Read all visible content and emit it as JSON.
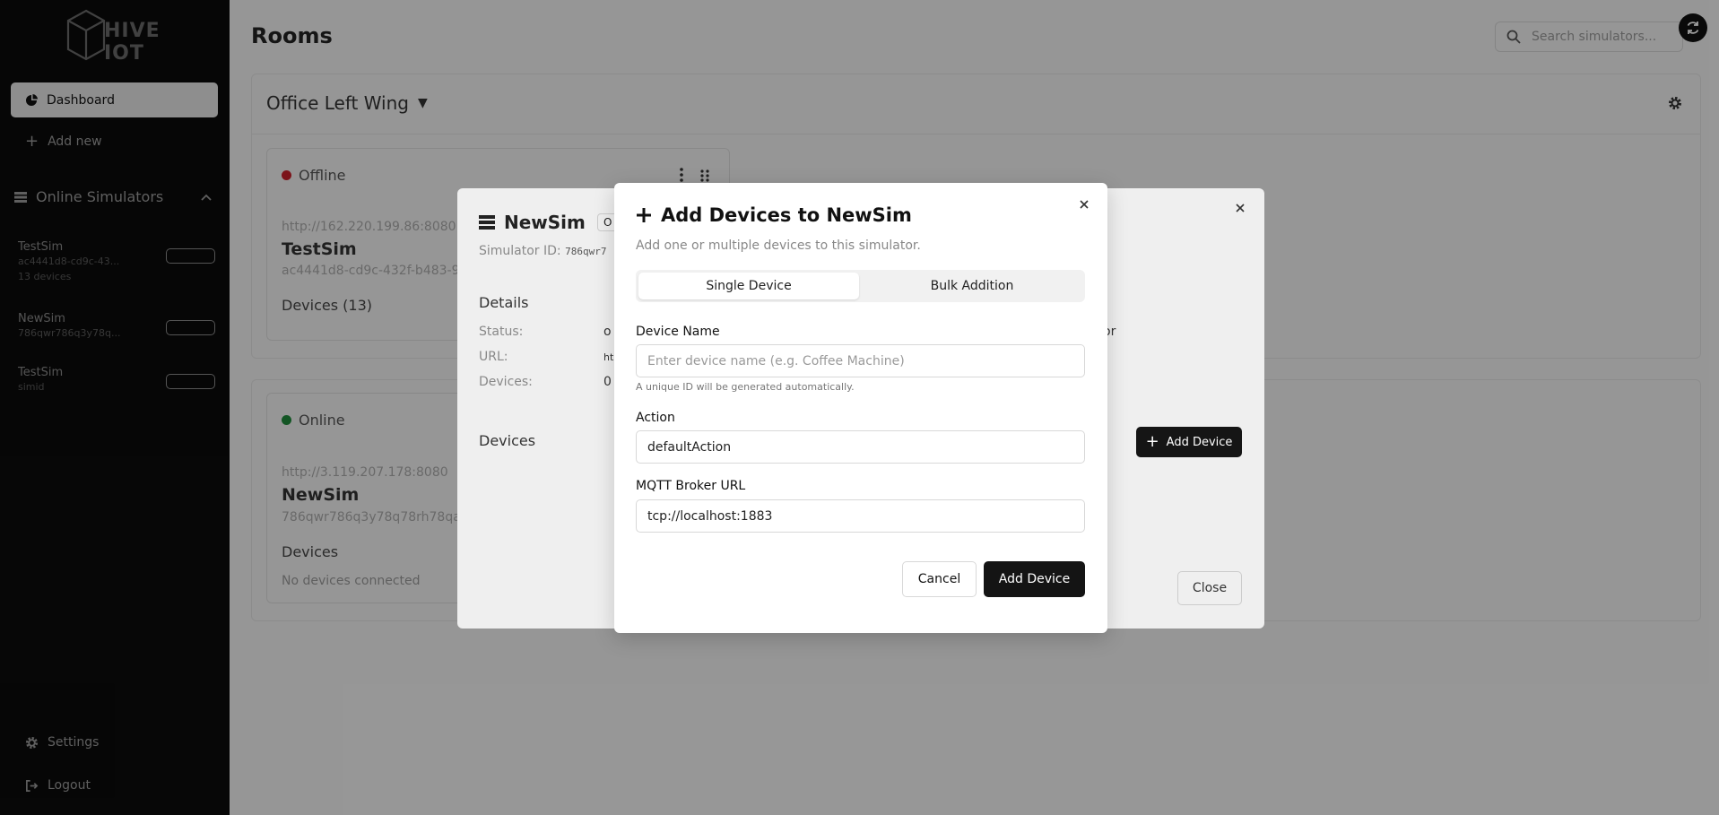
{
  "sidebar": {
    "logo_text": "HIVE IOT",
    "nav": {
      "dashboard": "Dashboard",
      "add_new": "Add new"
    },
    "section_title": "Online Simulators",
    "simulators": [
      {
        "name": "TestSim",
        "id": "ac4441d8-cd9c-43...",
        "count": "13 devices"
      },
      {
        "name": "NewSim",
        "id": "786qwr786q3y78q..."
      },
      {
        "name": "TestSim",
        "id": "simid"
      }
    ],
    "settings": "Settings",
    "logout": "Logout"
  },
  "header": {
    "title": "Rooms",
    "search_placeholder": "Search simulators..."
  },
  "room": {
    "name": "Office Left Wing",
    "cards": [
      {
        "status": "Offline",
        "status_color": "#c8202b",
        "url": "http://162.220.199.86:8080",
        "name": "TestSim",
        "id": "ac4441d8-cd9c-432f-b483-9",
        "devices": "Devices (13)"
      },
      {
        "status": "Online",
        "status_color": "#1f8a3a",
        "url": "http://3.119.207.178:8080",
        "name": "NewSim",
        "id": "786qwr786q3y78q78rh78qa",
        "devices": "Devices",
        "empty": "No devices connected"
      }
    ]
  },
  "detail_dialog": {
    "title": "NewSim",
    "badge": "O",
    "simulator_id_label": "Simulator ID:",
    "simulator_id": "786qwr7",
    "details_heading": "Details",
    "status_label": "Status:",
    "status_value": "o",
    "url_label": "URL:",
    "url_value": "ht",
    "devices_label": "Devices:",
    "devices_value": "0",
    "extra": "or",
    "devices_heading": "Devices",
    "add_device": "Add Device",
    "close": "Close"
  },
  "modal": {
    "title": "Add Devices to NewSim",
    "subtitle": "Add one or multiple devices to this simulator.",
    "tabs": [
      "Single Device",
      "Bulk Addition"
    ],
    "device_name_label": "Device Name",
    "device_name_placeholder": "Enter device name (e.g. Coffee Machine)",
    "device_name_hint": "A unique ID will be generated automatically.",
    "action_label": "Action",
    "action_value": "defaultAction",
    "mqtt_label": "MQTT Broker URL",
    "mqtt_value": "tcp://localhost:1883",
    "cancel": "Cancel",
    "submit": "Add Device"
  }
}
